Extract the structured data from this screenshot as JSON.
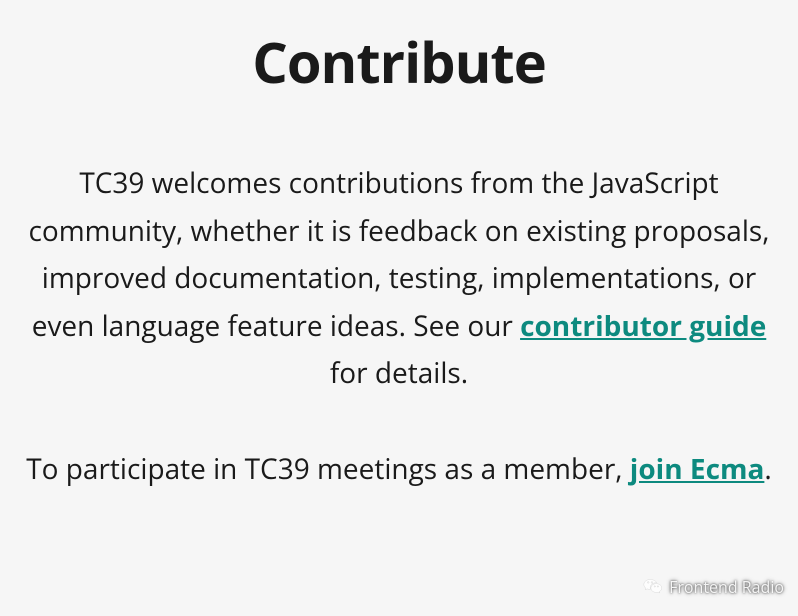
{
  "heading": "Contribute",
  "paragraph1": {
    "before": "TC39 welcomes contributions from the JavaScript community, whether it is feedback on existing proposals, improved documentation, testing, implementations, or even language feature ideas. See our ",
    "link_text": "contributor guide",
    "after": " for details."
  },
  "paragraph2": {
    "before": "To participate in TC39 meetings as a member, ",
    "link_text": "join Ecma",
    "after": "."
  },
  "watermark": {
    "label": "Frontend Radio"
  },
  "colors": {
    "link": "#0d8a7f",
    "background": "#f6f6f6",
    "text": "#1a1a1a"
  }
}
